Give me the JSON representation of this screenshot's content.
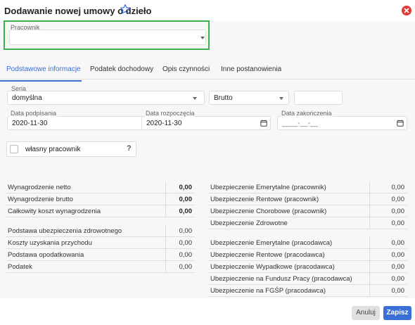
{
  "window": {
    "title": "Dodawanie nowej umowy o dzieło"
  },
  "employee": {
    "label": "Pracownik",
    "value": ""
  },
  "tabs": [
    {
      "label": "Podstawowe informacje"
    },
    {
      "label": "Podatek dochodowy"
    },
    {
      "label": "Opis czynności"
    },
    {
      "label": "Inne postanowienia"
    }
  ],
  "form": {
    "series_label": "Seria",
    "series_value": "domyślna",
    "gross_value": "Brutto",
    "amount_value": "",
    "sign_date_label": "Data podpisania",
    "sign_date_value": "2020-11-30",
    "start_date_label": "Data rozpoczęcia",
    "start_date_value": "2020-11-30",
    "end_date_label": "Data zakończenia",
    "end_date_value": "____-__-__",
    "own_employee_label": "własny pracownik",
    "help_symbol": "?"
  },
  "summary_left": [
    {
      "label": "Wynagrodzenie netto",
      "value": "0,00",
      "bold": true
    },
    {
      "label": "Wynagrodzenie brutto",
      "value": "0,00",
      "bold": true
    },
    {
      "label": "Całkowity koszt wynagrodzenia",
      "value": "0,00",
      "bold": true
    },
    {
      "label": "Podstawa ubezpieczenia zdrowotnego",
      "value": "0,00",
      "bold": false
    },
    {
      "label": "Koszty uzyskania przychodu",
      "value": "0,00",
      "bold": false
    },
    {
      "label": "Podstawa opodatkowania",
      "value": "0,00",
      "bold": false
    },
    {
      "label": "Podatek",
      "value": "0,00",
      "bold": false
    }
  ],
  "summary_right": [
    {
      "label": "Ubezpieczenie Emerytalne (pracownik)",
      "value": "0,00"
    },
    {
      "label": "Ubezpieczenie Rentowe (pracownik)",
      "value": "0,00"
    },
    {
      "label": "Ubezpieczenie Chorobowe (pracownik)",
      "value": "0,00"
    },
    {
      "label": "Ubezpieczenie Zdrowotne",
      "value": "0,00"
    },
    {
      "label": "Ubezpieczenie Emerytalne (pracodawca)",
      "value": "0,00"
    },
    {
      "label": "Ubezpieczenie Rentowe (pracodawca)",
      "value": "0,00"
    },
    {
      "label": "Ubezpieczenie Wypadkowe (pracodawca)",
      "value": "0,00"
    },
    {
      "label": "Ubezpieczenie na Fundusz Pracy (pracodawca)",
      "value": "0,00"
    },
    {
      "label": "Ubezpieczenie na FGŚP (pracodawca)",
      "value": "0,00"
    }
  ],
  "footer": {
    "cancel_label": "Anuluj",
    "save_label": "Zapisz"
  },
  "colors": {
    "accent": "#3a6fd8",
    "highlight": "#3fb14a",
    "close": "#e53935"
  },
  "icons": [
    "star-icon",
    "close-icon",
    "calendar-icon",
    "chevron-down-icon"
  ]
}
